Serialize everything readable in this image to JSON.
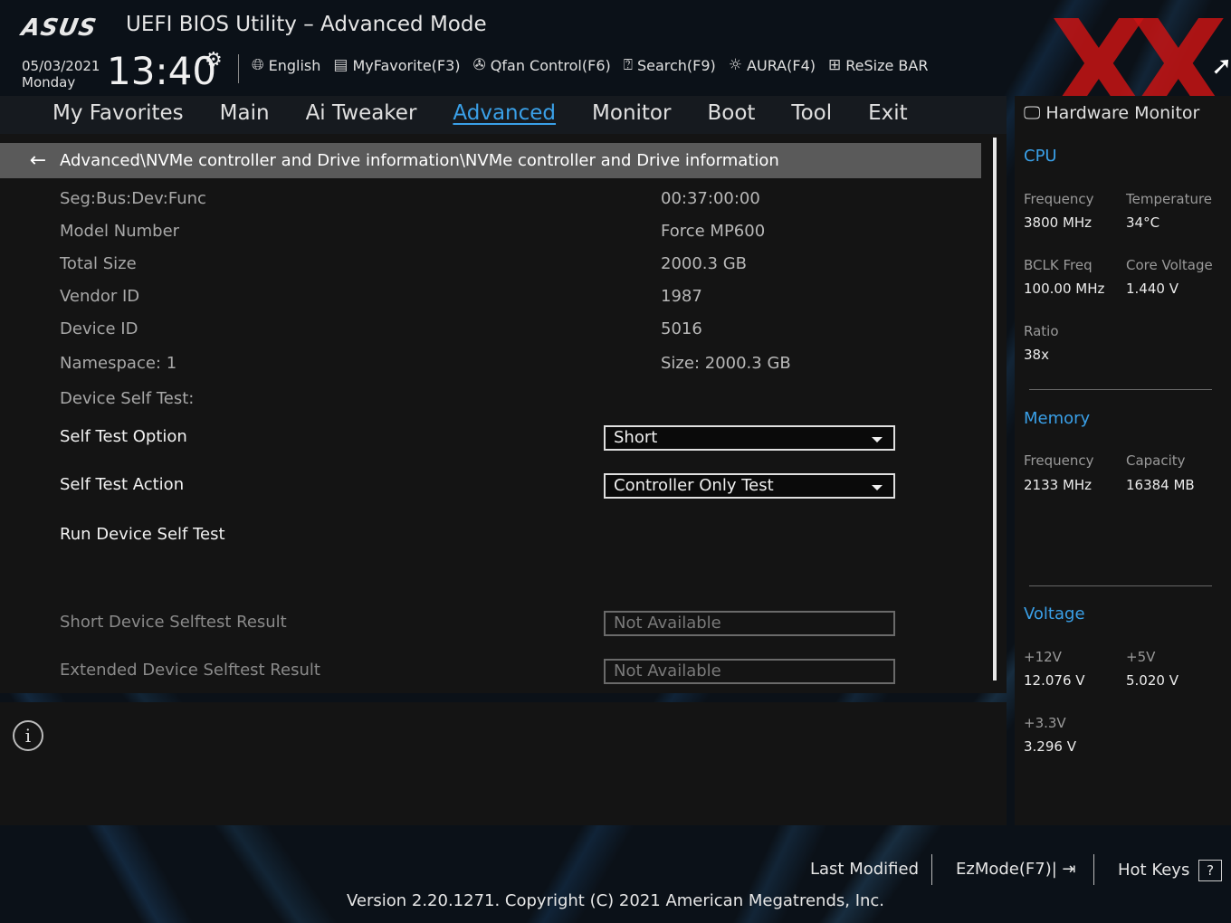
{
  "header": {
    "logo": "ASUS",
    "title": "UEFI BIOS Utility – Advanced Mode",
    "date": "05/03/2021",
    "weekday": "Monday",
    "time": "13:40",
    "tools": [
      {
        "label": "English",
        "icon": "globe-icon"
      },
      {
        "label": "MyFavorite(F3)",
        "icon": "favorite-list-icon"
      },
      {
        "label": "Qfan Control(F6)",
        "icon": "fan-icon"
      },
      {
        "label": "Search(F9)",
        "icon": "search-icon"
      },
      {
        "label": "AURA(F4)",
        "icon": "aura-light-icon"
      },
      {
        "label": "ReSize BAR",
        "icon": "resize-bar-icon"
      }
    ]
  },
  "nav": {
    "tabs": [
      "My Favorites",
      "Main",
      "Ai Tweaker",
      "Advanced",
      "Monitor",
      "Boot",
      "Tool",
      "Exit"
    ],
    "active": "Advanced"
  },
  "main": {
    "breadcrumb": "Advanced\\NVMe controller and Drive information\\NVMe controller and Drive information",
    "info_rows": [
      {
        "label": "Seg:Bus:Dev:Func",
        "value": "00:37:00:00"
      },
      {
        "label": "Model Number",
        "value": "Force MP600"
      },
      {
        "label": "Total Size",
        "value": "2000.3 GB"
      },
      {
        "label": "Vendor ID",
        "value": "1987"
      },
      {
        "label": "Device ID",
        "value": "5016"
      },
      {
        "label": "Namespace: 1",
        "value": "Size: 2000.3 GB"
      }
    ],
    "self_test_heading": "Device Self Test:",
    "self_test_option": {
      "label": "Self Test Option",
      "value": "Short"
    },
    "self_test_action": {
      "label": "Self Test Action",
      "value": "Controller Only Test"
    },
    "run_test": "Run Device Self Test",
    "short_result": {
      "label": "Short Device Selftest Result",
      "value": "Not Available"
    },
    "extended_result": {
      "label": "Extended Device Selftest Result",
      "value": "Not Available"
    }
  },
  "hw_monitor": {
    "title": "Hardware Monitor",
    "cpu": {
      "heading": "CPU",
      "frequency_label": "Frequency",
      "frequency": "3800 MHz",
      "temperature_label": "Temperature",
      "temperature": "34°C",
      "bclk_label": "BCLK Freq",
      "bclk": "100.00 MHz",
      "core_voltage_label": "Core Voltage",
      "core_voltage": "1.440 V",
      "ratio_label": "Ratio",
      "ratio": "38x"
    },
    "memory": {
      "heading": "Memory",
      "frequency_label": "Frequency",
      "frequency": "2133 MHz",
      "capacity_label": "Capacity",
      "capacity": "16384 MB"
    },
    "voltage": {
      "heading": "Voltage",
      "v12_label": "+12V",
      "v12": "12.076 V",
      "v5_label": "+5V",
      "v5": "5.020 V",
      "v33_label": "+3.3V",
      "v33": "3.296 V"
    }
  },
  "footer": {
    "last_modified": "Last Modified",
    "ezmode": "EzMode(F7)|",
    "hotkeys": "Hot Keys",
    "hotkeys_icon": "?",
    "version": "Version 2.20.1271. Copyright (C) 2021 American Megatrends, Inc."
  },
  "colors": {
    "accent": "#3aa0e8",
    "watermark": "#c81414"
  }
}
